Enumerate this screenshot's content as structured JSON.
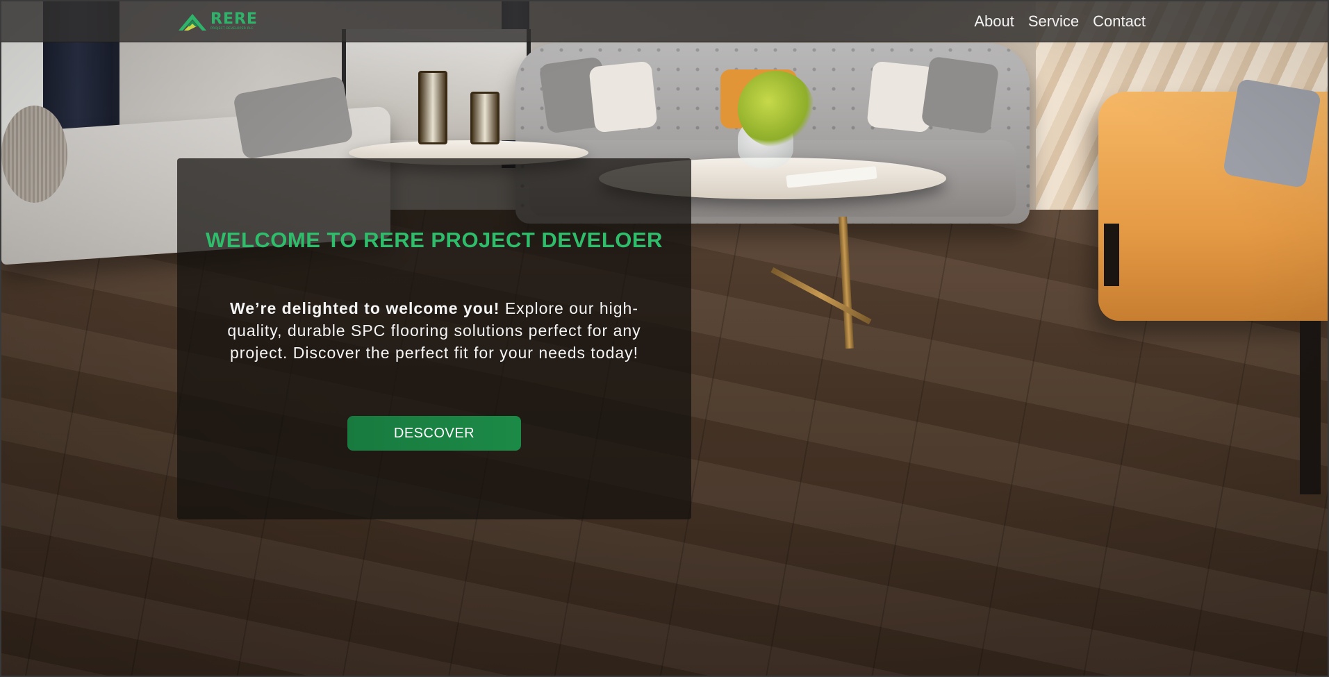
{
  "brand": {
    "name": "RERE",
    "subtitle": "PROJECT DEVELOPER PLC",
    "color": "#2fb36a"
  },
  "nav": {
    "items": [
      {
        "label": "About"
      },
      {
        "label": "Service"
      },
      {
        "label": "Contact"
      }
    ]
  },
  "hero": {
    "title": "WELCOME TO RERE PROJECT DEVELOER",
    "text_bold": "We’re delighted to welcome you!",
    "text_rest": " Explore our high-quality, durable SPC flooring solutions perfect for any project. Discover the perfect fit for your needs today!",
    "button_label": "DESCOVER",
    "title_color": "#2fbd6c",
    "button_color": "#1c8a47"
  },
  "icons": {
    "logo": "house-roof-logo-icon"
  }
}
